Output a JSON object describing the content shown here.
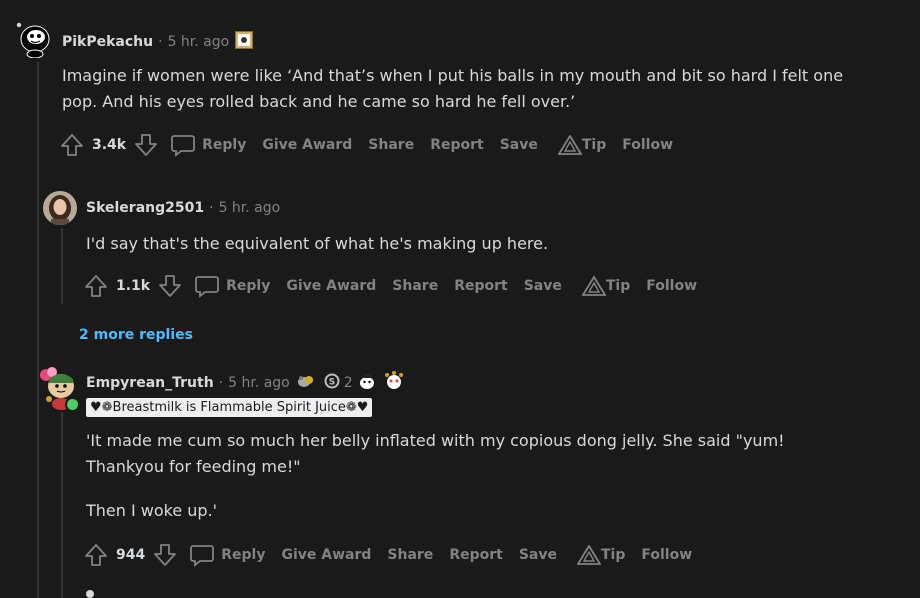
{
  "comments": [
    {
      "author": "PikPekachu",
      "time": "5 hr. ago",
      "body_lines": [
        "Imagine if women were like ‘And that’s when I put his balls in my mouth and bit so hard I felt one",
        "pop. And his eyes rolled back and he came so hard he fell over.’"
      ],
      "votes": "3.4k"
    },
    {
      "author": "Skelerang2501",
      "time": "5 hr. ago",
      "body_lines": [
        "I'd say that's the equivalent of what he's making up here."
      ],
      "votes": "1.1k"
    },
    {
      "author": "Empyrean_Truth",
      "time": "5 hr. ago",
      "award_count": "2",
      "flair": "♥❁Breastmilk is Flammable Spirit Juice❁♥",
      "body_lines": [
        "'It made me cum so much her belly inflated with my copious dong jelly. She said \"yum!",
        "Thankyou for feeding me!\"",
        "Then I woke up.'"
      ],
      "votes": "944"
    }
  ],
  "actions": {
    "reply": "Reply",
    "give_award": "Give Award",
    "share": "Share",
    "report": "Report",
    "save": "Save",
    "tip": "Tip",
    "follow": "Follow"
  },
  "more_replies": "2 more replies",
  "colors": {
    "background": "#1a1a1b",
    "text": "#d7dadc",
    "muted": "#818384",
    "link": "#4fbcff",
    "online": "#46d160"
  }
}
